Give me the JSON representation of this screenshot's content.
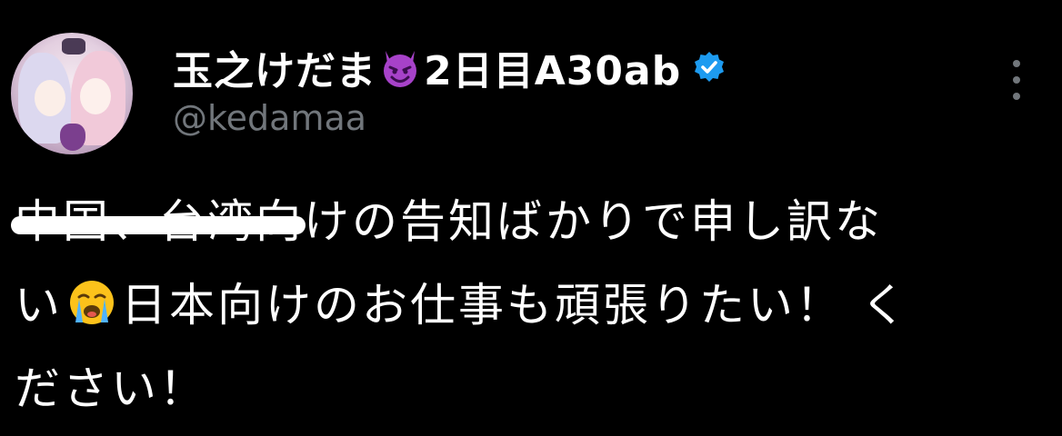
{
  "post": {
    "display_name_part1": "玉之けだま",
    "display_name_part2": "2日目A30ab",
    "handle": "@kedamaa",
    "emoji_after_name": "smiling-devil-icon",
    "verified_badge": "verified-badge-icon",
    "more_options": "more-options-icon",
    "text": {
      "struck_text": "中国、台湾向",
      "line1_rest": "けの告知ばかりで申し訳な",
      "line2_start": "い",
      "line2_emoji": "loudly-crying-face-icon",
      "line2_rest": "日本向けのお仕事も頑張りたい！ く",
      "line3": "ださい！"
    }
  },
  "colors": {
    "background": "#000000",
    "text_primary": "#ffffff",
    "text_secondary": "#71767b",
    "verified_blue": "#1d9bf0",
    "devil_purple": "#a742c9"
  }
}
